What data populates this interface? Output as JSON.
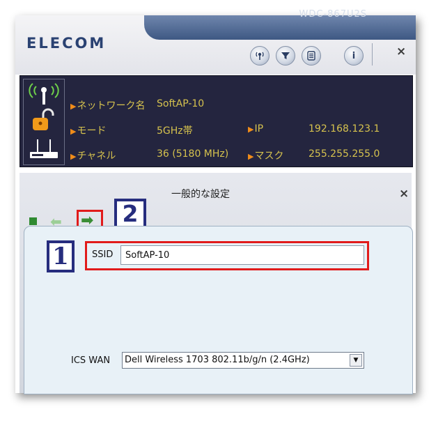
{
  "header": {
    "model": "WDC-867U2S",
    "logo": "ELECOM",
    "icons": [
      "signal-icon",
      "filter-icon",
      "list-icon",
      "info-icon"
    ],
    "info_icon_glyph": "i",
    "close": "×"
  },
  "info_panel": {
    "network_name_label": "ネットワーク名",
    "network_name_value": "SoftAP-10",
    "mode_label": "モード",
    "mode_value": "5GHz帯",
    "channel_label": "チャネル",
    "channel_value": "36 (5180 MHz)",
    "ip_label": "IP",
    "ip_value": "192.168.123.1",
    "mask_label": "マスク",
    "mask_value": "255.255.255.0"
  },
  "settings_panel": {
    "title": "一般的な設定",
    "close": "×",
    "step_1": "1",
    "step_2": "2",
    "ssid_label": "SSID",
    "ssid_value": "SoftAP-10",
    "ics_wan_label": "ICS WAN",
    "ics_wan_value": "Dell Wireless 1703 802.11b/g/n (2.4GHz)"
  },
  "colors": {
    "info_bg": "#24253f",
    "info_text": "#d6c24e",
    "highlight_red": "#e11b1b",
    "step_badge": "#262d7e"
  }
}
